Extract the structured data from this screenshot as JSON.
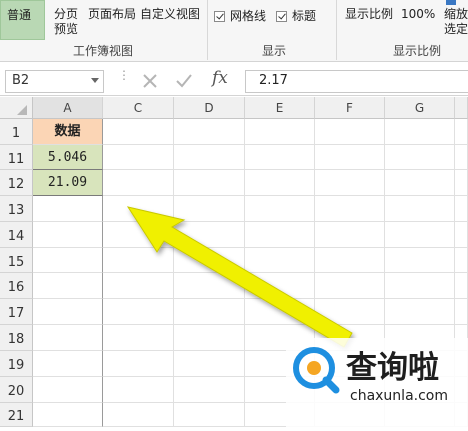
{
  "ribbon": {
    "normal_label": "普通",
    "page_break_label_line1": "分页",
    "page_break_label_line2": "预览",
    "page_layout_label": "页面布局",
    "custom_view_label": "自定义视图",
    "workbook_views_group": "工作簿视图",
    "gridlines_label": "网格线",
    "headings_label": "标题",
    "show_group": "显示",
    "zoom_label": "显示比例",
    "zoom_100_label": "100%",
    "zoom_selection_line1": "缩放",
    "zoom_selection_line2": "选定",
    "zoom_group": "显示比例"
  },
  "formula_bar": {
    "name_box": "B2",
    "fx_label": "fx",
    "value": "2.17"
  },
  "grid": {
    "columns": [
      "A",
      "C",
      "D",
      "E",
      "F",
      "G"
    ],
    "rows": [
      {
        "num": "1",
        "a": "数据"
      },
      {
        "num": "11",
        "a": "5.046"
      },
      {
        "num": "12",
        "a": "21.09"
      },
      {
        "num": "13",
        "a": ""
      },
      {
        "num": "14",
        "a": ""
      },
      {
        "num": "15",
        "a": ""
      },
      {
        "num": "16",
        "a": ""
      },
      {
        "num": "17",
        "a": ""
      },
      {
        "num": "18",
        "a": ""
      },
      {
        "num": "19",
        "a": ""
      },
      {
        "num": "20",
        "a": ""
      },
      {
        "num": "21",
        "a": ""
      }
    ]
  },
  "watermark": {
    "name": "查询啦",
    "url": "chaxunla.com"
  },
  "colors": {
    "header_cell": "#fbd5b5",
    "data_cell": "#d8e4bc",
    "arrow": "#f0f000",
    "logo_blue": "#1e8fe0",
    "logo_orange": "#f5a623"
  }
}
